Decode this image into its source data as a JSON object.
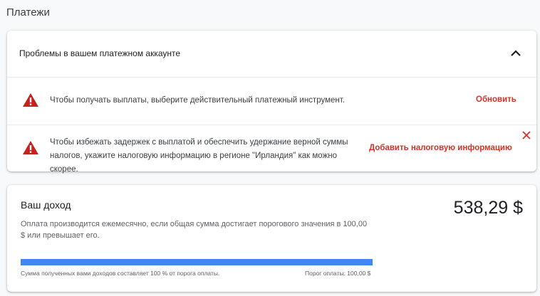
{
  "page": {
    "title": "Платежи"
  },
  "issues": {
    "title": "Проблемы в вашем платежном аккаунте",
    "collapse_icon": "chevron-up-icon",
    "items": [
      {
        "icon": "warning-icon",
        "text": "Чтобы получать выплаты, выберите действительный платежный инструмент.",
        "action": "Обновить"
      },
      {
        "icon": "warning-icon",
        "text": "Чтобы избежать задержек с выплатой и обеспечить удержание верной суммы налогов, укажите налоговую информацию в регионе \"Ирландия\" как можно скорее.",
        "action": "Добавить налоговую информацию",
        "dismiss_icon": "close-icon"
      }
    ]
  },
  "income": {
    "title": "Ваш доход",
    "amount": "538,29 $",
    "description": "Оплата производится ежемесячно, если общая сумма достигает порогового значения в 100,00 $ или превышает его.",
    "progress_percent": 100,
    "progress_caption": "Сумма полученных вами доходов составляет 100 % от порога оплаты.",
    "threshold_caption": "Порог оплаты: 100,00 $"
  },
  "colors": {
    "accent_red": "#d93025",
    "progress_blue": "#4285f4",
    "background": "#f8f9fa"
  }
}
